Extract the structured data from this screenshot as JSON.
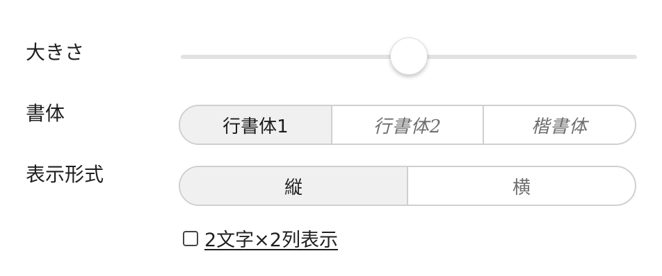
{
  "labels": {
    "size": "大きさ",
    "font": "書体",
    "layout": "表示形式"
  },
  "size_slider": {
    "value_fraction": 0.5
  },
  "font_options": [
    {
      "label": "行書体1",
      "selected": true
    },
    {
      "label": "行書体2",
      "selected": false
    },
    {
      "label": "楷書体",
      "selected": false
    }
  ],
  "layout_options": [
    {
      "label": "縦",
      "selected": true
    },
    {
      "label": "横",
      "selected": false
    }
  ],
  "two_by_two": {
    "label": "2文字×2列表示",
    "checked": false
  },
  "colors": {
    "selected_bg": "#f0f0f0",
    "border": "#cfcfcf",
    "track": "#e2e2e2"
  }
}
